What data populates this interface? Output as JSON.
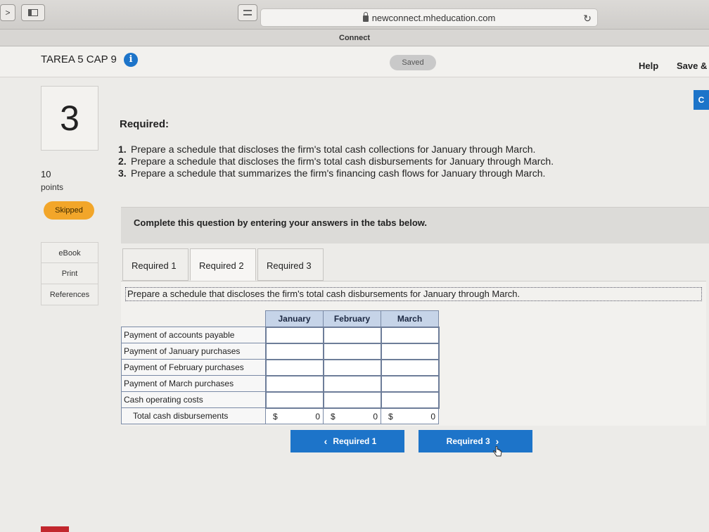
{
  "browser": {
    "url": "newconnect.mheducation.com",
    "tab_title": "Connect"
  },
  "header": {
    "assignment_title": "TAREA 5 CAP 9",
    "saved_label": "Saved",
    "help_label": "Help",
    "save_label": "Save &"
  },
  "question": {
    "number": "3",
    "points_value": "10",
    "points_label": "points",
    "status": "Skipped",
    "continue_label": "C"
  },
  "side_links": [
    "eBook",
    "Print",
    "References"
  ],
  "content": {
    "required_heading": "Required:",
    "requirements": [
      {
        "n": "1.",
        "text": "Prepare a schedule that discloses the firm's total cash collections for January through March."
      },
      {
        "n": "2.",
        "text": "Prepare a schedule that discloses the firm's total cash disbursements for January through March."
      },
      {
        "n": "3.",
        "text": "Prepare a schedule that summarizes the firm's financing cash flows for January through March."
      }
    ],
    "instruction": "Complete this question by entering your answers in the tabs below.",
    "tabs": [
      "Required 1",
      "Required 2",
      "Required 3"
    ],
    "active_tab": "Required 2",
    "prompt": "Prepare a schedule that discloses the firm's total cash disbursements for January through March."
  },
  "table": {
    "columns": [
      "January",
      "February",
      "March"
    ],
    "rows": [
      "Payment of accounts payable",
      "Payment of January purchases",
      "Payment of February purchases",
      "Payment of March purchases",
      "Cash operating costs"
    ],
    "total_label": "Total cash disbursements",
    "currency": "$",
    "totals": [
      "0",
      "0",
      "0"
    ]
  },
  "nav": {
    "prev_label": "Required 1",
    "next_label": "Required 3"
  },
  "colors": {
    "accent": "#1d74c9",
    "skipped": "#f2a62a",
    "header_cell": "#c6d4e8"
  }
}
